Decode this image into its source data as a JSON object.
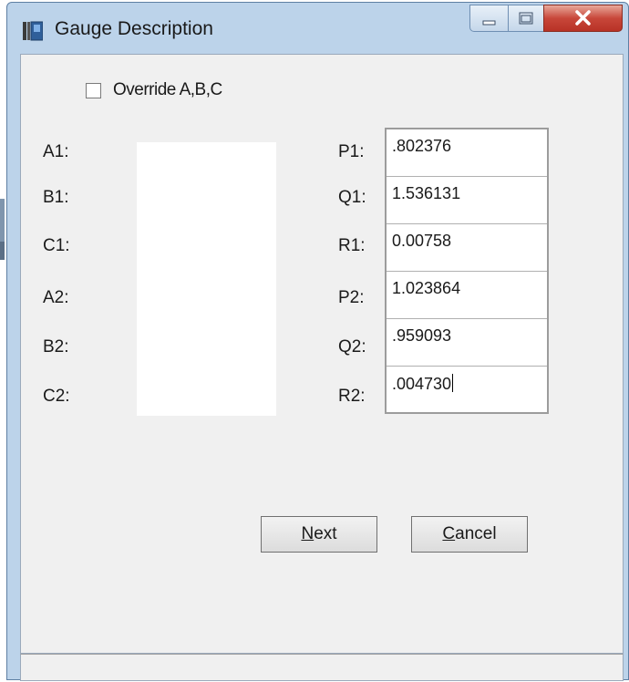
{
  "window": {
    "title": "Gauge Description",
    "icon": "gauge-app-icon",
    "controls": [
      "minimize-icon",
      "maximize-icon",
      "close-icon"
    ]
  },
  "override": {
    "label": "Override A,B,C",
    "checked": false
  },
  "left_labels": [
    "A1:",
    "B1:",
    "C1:",
    "A2:",
    "B2:",
    "C2:"
  ],
  "fields": [
    {
      "label": "P1:",
      "value": ".802376"
    },
    {
      "label": "Q1:",
      "value": "1.536131"
    },
    {
      "label": "R1:",
      "value": "0.00758"
    },
    {
      "label": "P2:",
      "value": "1.023864"
    },
    {
      "label": "Q2:",
      "value": ".959093"
    },
    {
      "label": "R2:",
      "value": ".004730"
    }
  ],
  "buttons": {
    "next": {
      "mnemonic": "N",
      "rest": "ext"
    },
    "cancel": {
      "mnemonic": "C",
      "rest": "ancel"
    }
  },
  "colors": {
    "close_button": "#c8473a",
    "client_background": "#f0f0f0",
    "frame": "#bcd3ea"
  }
}
